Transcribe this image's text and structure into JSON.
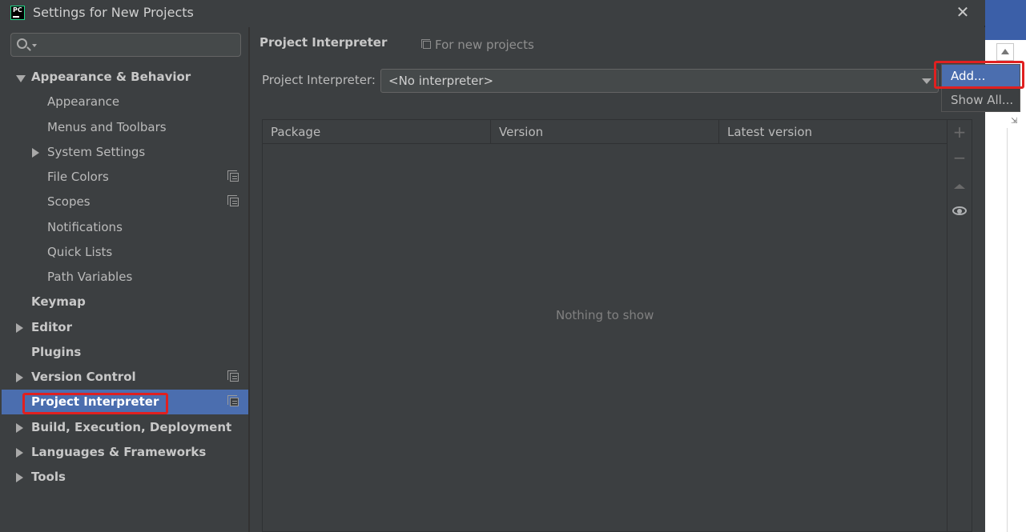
{
  "window": {
    "title": "Settings for New Projects",
    "close_glyph": "✕",
    "app_icon_text": "PC"
  },
  "sidebar": {
    "search_placeholder": "",
    "items": [
      {
        "label": "Appearance & Behavior",
        "level": 0,
        "bold": true,
        "arrow": "down",
        "copy": false
      },
      {
        "label": "Appearance",
        "level": 1,
        "bold": false,
        "arrow": "none",
        "copy": false
      },
      {
        "label": "Menus and Toolbars",
        "level": 1,
        "bold": false,
        "arrow": "none",
        "copy": false
      },
      {
        "label": "System Settings",
        "level": 1,
        "bold": false,
        "arrow": "right",
        "copy": false
      },
      {
        "label": "File Colors",
        "level": 1,
        "bold": false,
        "arrow": "none",
        "copy": true
      },
      {
        "label": "Scopes",
        "level": 1,
        "bold": false,
        "arrow": "none",
        "copy": true
      },
      {
        "label": "Notifications",
        "level": 1,
        "bold": false,
        "arrow": "none",
        "copy": false
      },
      {
        "label": "Quick Lists",
        "level": 1,
        "bold": false,
        "arrow": "none",
        "copy": false
      },
      {
        "label": "Path Variables",
        "level": 1,
        "bold": false,
        "arrow": "none",
        "copy": false
      },
      {
        "label": "Keymap",
        "level": 0,
        "bold": true,
        "arrow": "none",
        "copy": false
      },
      {
        "label": "Editor",
        "level": 0,
        "bold": true,
        "arrow": "right",
        "copy": false
      },
      {
        "label": "Plugins",
        "level": 0,
        "bold": true,
        "arrow": "none",
        "copy": false
      },
      {
        "label": "Version Control",
        "level": 0,
        "bold": true,
        "arrow": "right",
        "copy": true
      },
      {
        "label": "Project Interpreter",
        "level": 0,
        "bold": true,
        "arrow": "none",
        "copy": true,
        "selected": true
      },
      {
        "label": "Build, Execution, Deployment",
        "level": 0,
        "bold": true,
        "arrow": "right",
        "copy": false
      },
      {
        "label": "Languages & Frameworks",
        "level": 0,
        "bold": true,
        "arrow": "right",
        "copy": false
      },
      {
        "label": "Tools",
        "level": 0,
        "bold": true,
        "arrow": "right",
        "copy": false
      }
    ]
  },
  "main": {
    "section_title": "Project Interpreter",
    "scope_text": "For new projects",
    "interpreter_label": "Project Interpreter:",
    "interpreter_value": "<No interpreter>",
    "table": {
      "columns": [
        "Package",
        "Version",
        "Latest version"
      ],
      "rows": [],
      "empty_text": "Nothing to show"
    },
    "toolbar": {
      "add_glyph": "+",
      "remove_glyph": "−"
    }
  },
  "popup": {
    "items": [
      "Add...",
      "Show All..."
    ],
    "active_index": 0
  },
  "colors": {
    "background": "#3c3f41",
    "selection": "#4b6eaf",
    "highlight_annotation": "#e02020"
  }
}
